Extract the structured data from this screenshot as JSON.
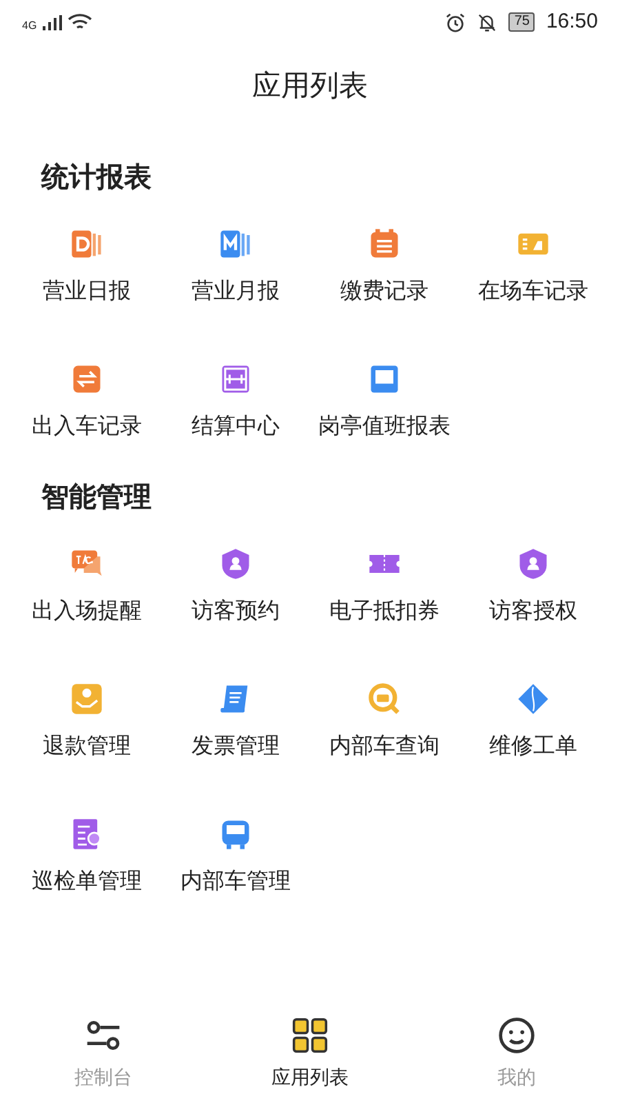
{
  "status_bar": {
    "network": "4G",
    "battery": "75",
    "time": "16:50"
  },
  "title": "应用列表",
  "sections": [
    {
      "title": "统计报表",
      "items": [
        {
          "label": "营业日报"
        },
        {
          "label": "营业月报"
        },
        {
          "label": "缴费记录"
        },
        {
          "label": "在场车记录"
        },
        {
          "label": "出入车记录"
        },
        {
          "label": "结算中心"
        },
        {
          "label": "岗亭值班报表"
        }
      ]
    },
    {
      "title": "智能管理",
      "items": [
        {
          "label": "出入场提醒"
        },
        {
          "label": "访客预约"
        },
        {
          "label": "电子抵扣券"
        },
        {
          "label": "访客授权"
        },
        {
          "label": "退款管理"
        },
        {
          "label": "发票管理"
        },
        {
          "label": "内部车查询"
        },
        {
          "label": "维修工单"
        },
        {
          "label": "巡检单管理"
        },
        {
          "label": "内部车管理"
        }
      ]
    }
  ],
  "tabs": [
    {
      "label": "控制台",
      "selected": false
    },
    {
      "label": "应用列表",
      "selected": true
    },
    {
      "label": "我的",
      "selected": false
    }
  ]
}
